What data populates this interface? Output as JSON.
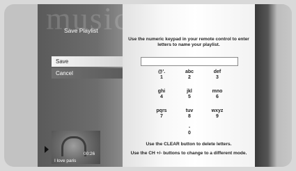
{
  "background": {
    "watermark": "music"
  },
  "screen": {
    "title": "Save Playlist"
  },
  "menu": {
    "items": [
      "Save",
      "Cancel"
    ],
    "selected_index": 0
  },
  "instructions": {
    "top": "Use the numeric keypad in your remote control to enter letters to name your playlist.",
    "clear": "Use the CLEAR button to delete letters.",
    "ch": "Use the CH +/- buttons to change to a different mode."
  },
  "input": {
    "value": ""
  },
  "keypad": {
    "keys": [
      {
        "letters": "@'.",
        "digit": "1"
      },
      {
        "letters": "abc",
        "digit": "2"
      },
      {
        "letters": "def",
        "digit": "3"
      },
      {
        "letters": "ghi",
        "digit": "4"
      },
      {
        "letters": "jkl",
        "digit": "5"
      },
      {
        "letters": "mno",
        "digit": "6"
      },
      {
        "letters": "pqrs",
        "digit": "7"
      },
      {
        "letters": "tuv",
        "digit": "8"
      },
      {
        "letters": "wxyz",
        "digit": "9"
      },
      {
        "letters": "-",
        "digit": "0"
      }
    ]
  },
  "now_playing": {
    "time": "00:26",
    "title": "I love paris",
    "icon": "headphones-icon"
  },
  "colors": {
    "selected_bg": "#f0f0f0",
    "menu_bg": "#6a6a6a"
  }
}
